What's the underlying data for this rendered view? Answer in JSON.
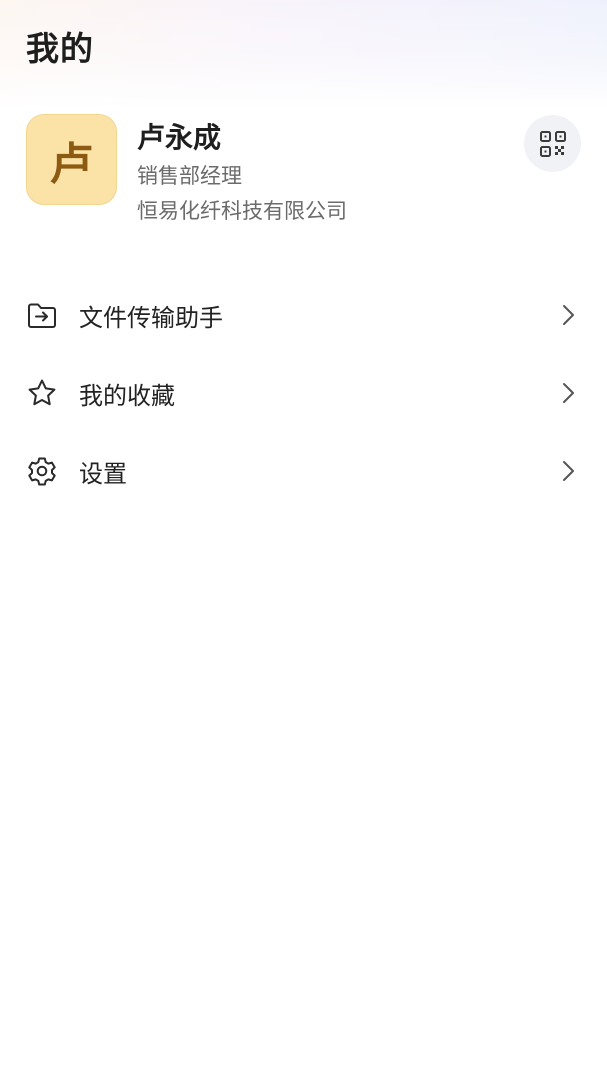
{
  "page": {
    "title": "我的"
  },
  "profile": {
    "avatar_text": "卢",
    "name": "卢永成",
    "role": "销售部经理",
    "company": "恒易化纤科技有限公司",
    "qr_icon": "qr-code-icon"
  },
  "menu": {
    "items": [
      {
        "label": "文件传输助手",
        "icon": "folder-transfer-icon"
      },
      {
        "label": "我的收藏",
        "icon": "star-icon"
      },
      {
        "label": "设置",
        "icon": "gear-icon"
      }
    ]
  },
  "colors": {
    "avatar_bg": "#fbe3a8",
    "avatar_text": "#8c5a10",
    "text_primary": "#1e1e1e",
    "text_secondary": "#6b6b6b",
    "qr_button_bg": "#f1f2f5"
  }
}
